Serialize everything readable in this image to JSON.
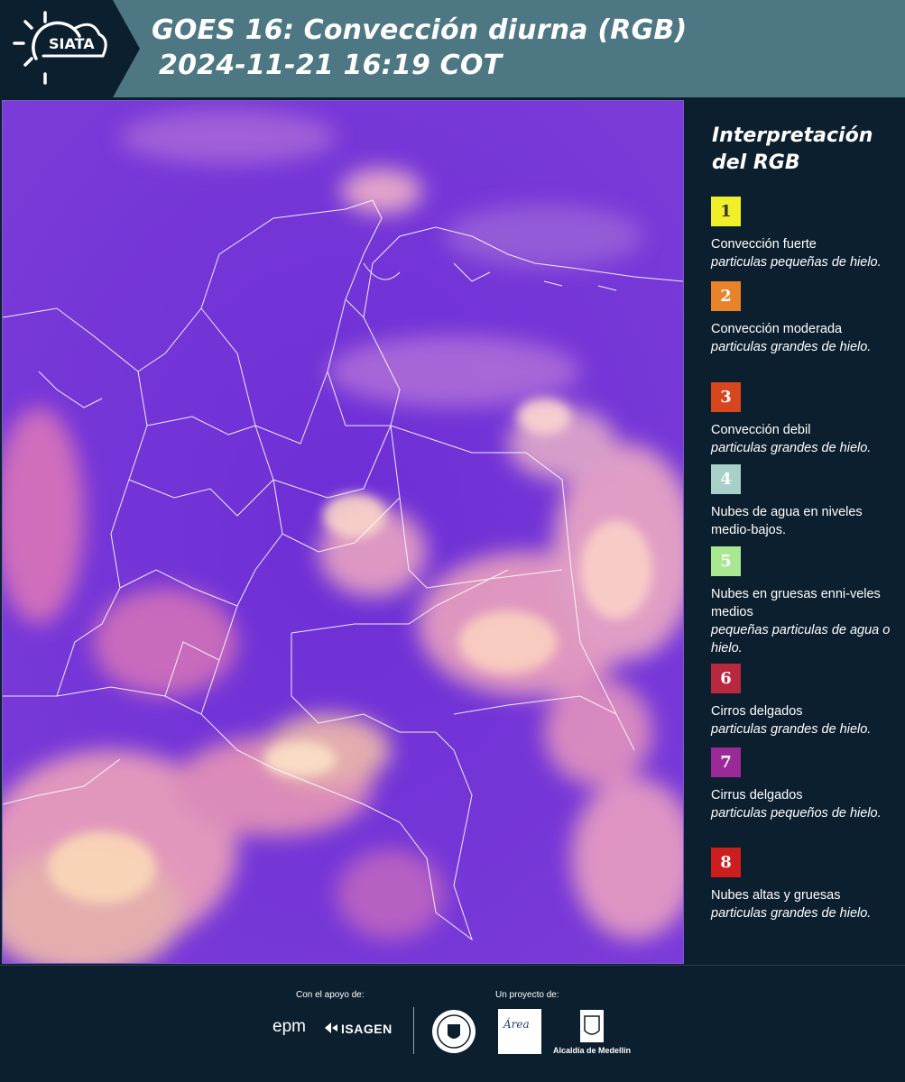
{
  "header": {
    "logo_text": "SIATA",
    "title_line1": "GOES 16: Convección diurna (RGB)",
    "title_line2": "2024-11-21 16:19 COT",
    "background_color": "#4e7784"
  },
  "map": {
    "base_color": "#7a3ad8",
    "boundary_color": "#ffffff"
  },
  "legend": {
    "title_line1": "Interpretación",
    "title_line2": "del RGB",
    "items": [
      {
        "number": "1",
        "color": "#f0f02a",
        "text_color": "#333333",
        "name": "Convección fuerte",
        "desc": "particulas pequeñas de hielo."
      },
      {
        "number": "2",
        "color": "#e8832a",
        "text_color": "#ffffff",
        "name": "Convección moderada",
        "desc": "particulas grandes de hielo."
      },
      {
        "number": "3",
        "color": "#d8461e",
        "text_color": "#ffffff",
        "name": "Convección debil",
        "desc": "particulas grandes de hielo."
      },
      {
        "number": "4",
        "color": "#a8d0c8",
        "text_color": "#ffffff",
        "name": "Nubes de agua en niveles medio-bajos.",
        "desc": ""
      },
      {
        "number": "5",
        "color": "#a8e890",
        "text_color": "#ffffff",
        "name": "Nubes en gruesas enni-veles medios",
        "desc": "pequeñas particulas de agua o hielo."
      },
      {
        "number": "6",
        "color": "#b8283e",
        "text_color": "#ffffff",
        "name": "Cirros delgados",
        "desc": "particulas grandes de hielo."
      },
      {
        "number": "7",
        "color": "#9a2a98",
        "text_color": "#ffffff",
        "name": "Cirrus delgados",
        "desc": "particulas pequeños de hielo."
      },
      {
        "number": "8",
        "color": "#cc1e1e",
        "text_color": "#ffffff",
        "name": "Nubes altas y gruesas",
        "desc": "particulas grandes de hielo."
      }
    ]
  },
  "footer": {
    "support_label": "Con el apoyo de:",
    "project_label": "Un proyecto de:",
    "sponsor1": "epm",
    "sponsor2": "ISAGEN",
    "partner1_text": "Área",
    "partner2_text": "Alcaldía de Medellín"
  }
}
